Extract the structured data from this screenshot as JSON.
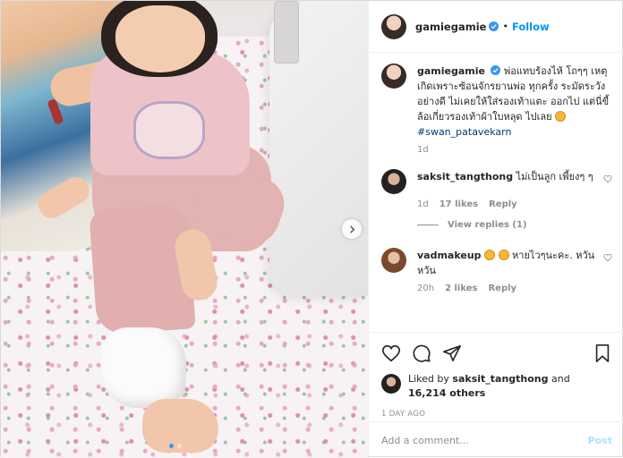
{
  "header": {
    "username": "gamiegamie",
    "separator": "•",
    "follow_label": "Follow"
  },
  "caption": {
    "username": "gamiegamie",
    "text": "พ่อแทบร้องไห้ โถๆๆ เหตุเกิดเพราะซ้อนจักรยานพ่อ ทุกครั้ง ระมัดระวังอย่างดี ไม่เคยให้ใส่รองเท้าแตะ ออกไป แต่นี่ขี้ล้อเกี่ยวรองเท้าผ้าใบหลุด ไปเลย",
    "hashtag": "#swan_patavekarn",
    "time": "1d"
  },
  "comments": [
    {
      "username": "saksit_tangthong",
      "text": "ไม่เป็นลูก เพี้ยงๆ ๆ",
      "time": "1d",
      "likes": "17 likes",
      "reply_label": "Reply",
      "view_replies": "View replies (1)"
    },
    {
      "username": "vadmakeup",
      "text": "หายไวๆนะคะ. หวัน หวัน",
      "time": "20h",
      "likes": "2 likes",
      "reply_label": "Reply"
    }
  ],
  "likes": {
    "prefix": "Liked by",
    "user": "saksit_tangthong",
    "joiner": "and",
    "others": "16,214 others"
  },
  "post_time": "1 DAY AGO",
  "add_comment": {
    "placeholder": "Add a comment...",
    "post_label": "Post"
  },
  "colors": {
    "accent": "#0095f6",
    "muted": "#8e8e8e",
    "hashtag": "#00376b",
    "post_disabled": "#b2dffc",
    "carousel_active": "#3897f0"
  }
}
